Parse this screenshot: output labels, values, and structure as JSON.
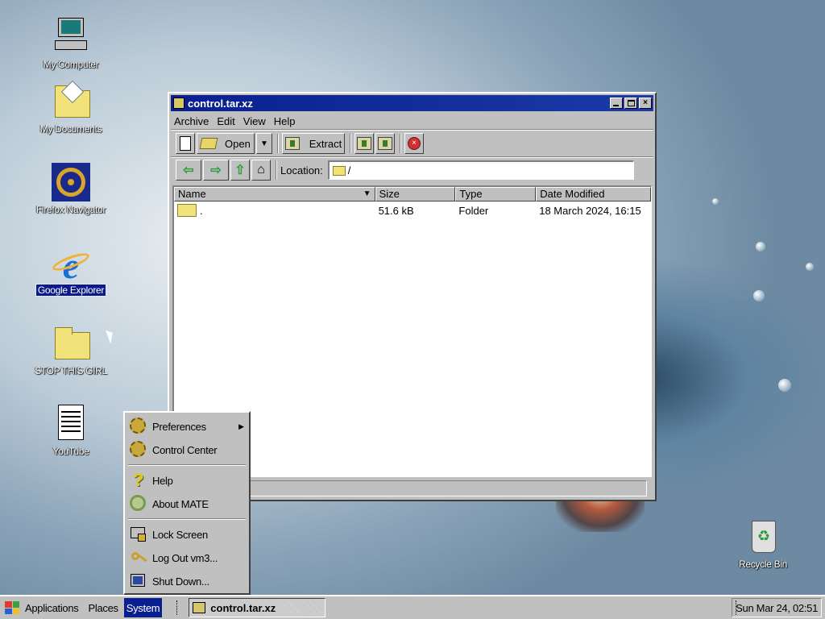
{
  "desktop": {
    "icons": [
      {
        "label": "My Computer"
      },
      {
        "label": "My Documents"
      },
      {
        "label": "Firefox Navigator"
      },
      {
        "label": "Google Explorer"
      },
      {
        "label": "STOP THIS GIRL"
      },
      {
        "label": "YouTube"
      },
      {
        "label": "Recycle Bin"
      }
    ]
  },
  "window": {
    "title": "control.tar.xz",
    "menu": [
      "Archive",
      "Edit",
      "View",
      "Help"
    ],
    "toolbar": {
      "open_label": "Open",
      "extract_label": "Extract"
    },
    "location": {
      "label": "Location:",
      "value": "/"
    },
    "columns": [
      "Name",
      "Size",
      "Type",
      "Date Modified"
    ],
    "rows": [
      {
        "name": ".",
        "size": "51.6 kB",
        "type": "Folder",
        "modified": "18 March 2024, 16:15"
      }
    ]
  },
  "system_menu": {
    "items": [
      "Preferences",
      "Control Center",
      "Help",
      "About MATE",
      "Lock Screen",
      "Log Out vm3...",
      "Shut Down..."
    ]
  },
  "taskbar": {
    "menus": [
      "Applications",
      "Places",
      "System"
    ],
    "active_menu": "System",
    "window_button": "control.tar.xz",
    "clock": "Sun Mar 24, 02:51"
  }
}
